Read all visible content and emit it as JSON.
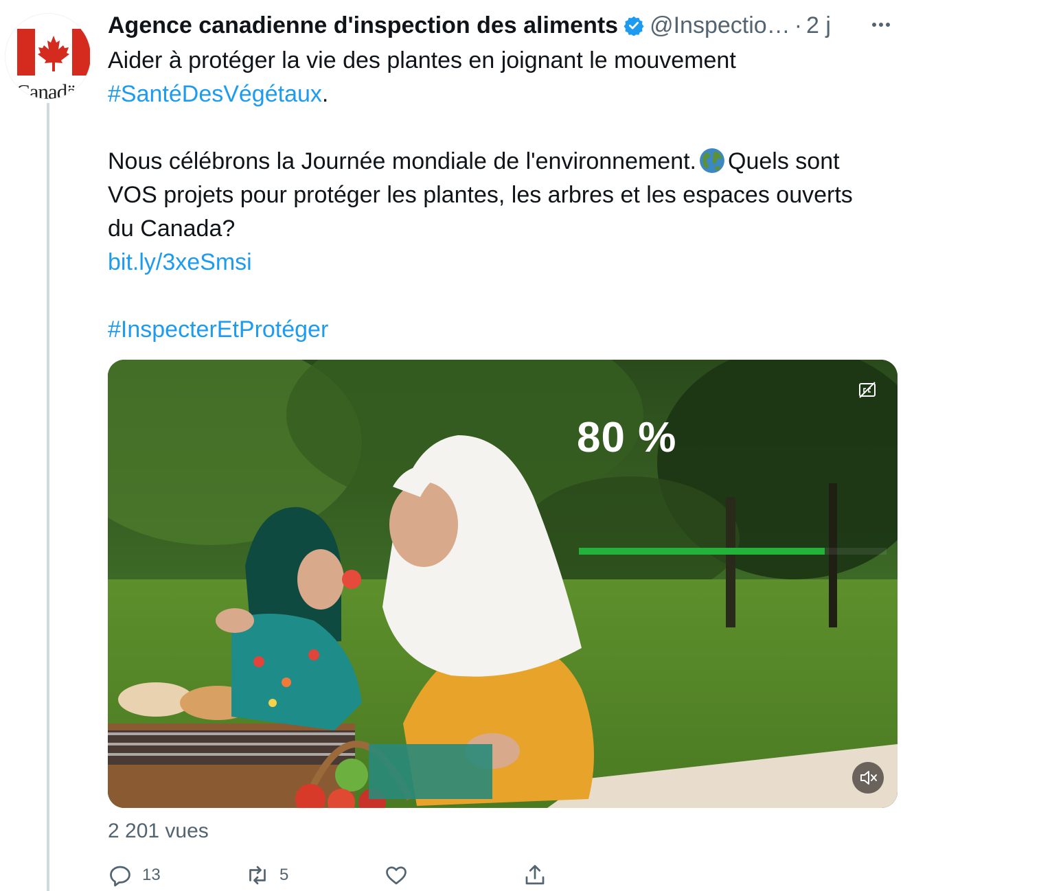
{
  "tweet": {
    "author_name": "Agence canadienne d'inspection des aliments",
    "handle": "@Inspectio…",
    "separator": "·",
    "time": "2 j",
    "avatar_wordmark": "Canadä",
    "text_line1": "Aider à protéger la vie des plantes en joignant le mouvement",
    "hashtag1": "#SantéDesVégétaux",
    "period": ".",
    "text_para2_a": "Nous célébrons la Journée mondiale de l'environnement.",
    "text_para2_b": "Quels sont",
    "text_para2_c": "VOS projets pour protéger les plantes, les arbres et les espaces ouverts",
    "text_para2_d": "du Canada?",
    "link": "bit.ly/3xeSmsi",
    "hashtag2": "#InspecterEtProtéger"
  },
  "media": {
    "overlay_stat": "80 %",
    "progress_fraction": 0.8,
    "accent_color": "#23b23a"
  },
  "footer": {
    "views": "2 201 vues",
    "reply_count": "13",
    "retweet_count": "5"
  },
  "icons": {
    "verified": "verified-badge-icon",
    "more": "more-icon",
    "reply": "reply-icon",
    "retweet": "retweet-icon",
    "like": "like-icon",
    "share": "share-icon",
    "captions": "captions-icon",
    "mute": "mute-icon",
    "globe": "globe-emoji-icon"
  },
  "colors": {
    "link": "#1d9bf0",
    "secondary_text": "#536471",
    "canada_red": "#d52b1e"
  }
}
